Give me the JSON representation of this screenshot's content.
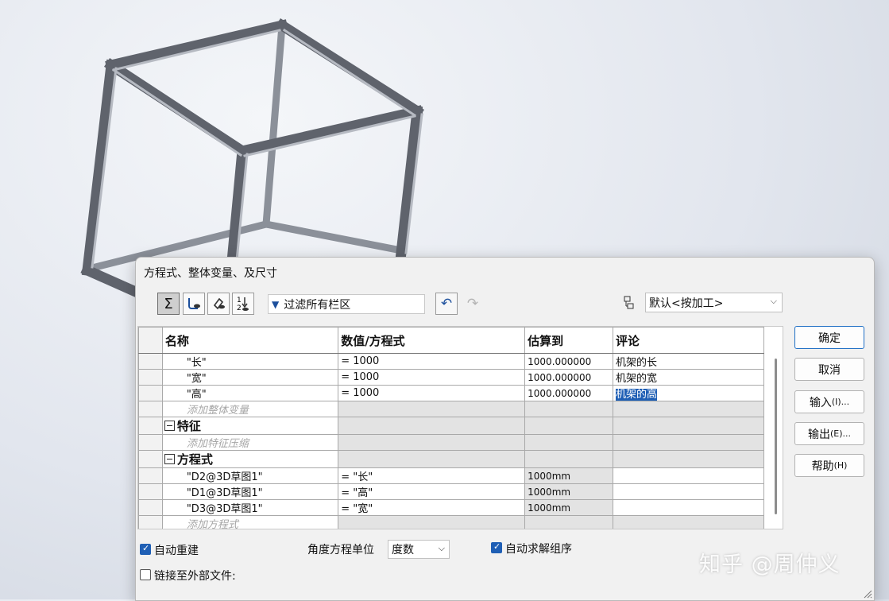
{
  "dialog": {
    "title": "方程式、整体变量、及尺寸",
    "toolbar": {
      "equation_view_icon": "sigma-icon",
      "sketch_equation_view_icon": "sketch-view-icon",
      "dimension_view_icon": "dimension-view-icon",
      "ordered_view_icon": "ordered-view-icon",
      "filter_placeholder": "过滤所有栏区",
      "configuration": "默认<按加工>"
    },
    "table": {
      "headers": [
        "名称",
        "数值/方程式",
        "估算到",
        "评论"
      ],
      "globals": [
        {
          "name": "\"长\"",
          "value": "= 1000",
          "evaluates": "1000.000000",
          "comment": "机架的长"
        },
        {
          "name": "\"宽\"",
          "value": "= 1000",
          "evaluates": "1000.000000",
          "comment": "机架的宽"
        },
        {
          "name": "\"高\"",
          "value": "= 1000",
          "evaluates": "1000.000000",
          "comment": "机架的高"
        }
      ],
      "add_global_hint": "添加整体变量",
      "features_section": "特征",
      "add_feature_hint": "添加特征压缩",
      "equations_section": "方程式",
      "equations": [
        {
          "name": "\"D2@3D草图1\"",
          "value": "= \"长\"",
          "evaluates": "1000mm"
        },
        {
          "name": "\"D1@3D草图1\"",
          "value": "= \"高\"",
          "evaluates": "1000mm"
        },
        {
          "name": "\"D3@3D草图1\"",
          "value": "= \"宽\"",
          "evaluates": "1000mm"
        }
      ],
      "add_equation_hint": "添加方程式"
    },
    "buttons": {
      "ok": "确定",
      "cancel": "取消",
      "import": "输入",
      "import_key": "(I)...",
      "export": "输出",
      "export_key": "(E)...",
      "help": "帮助",
      "help_key": "(H)"
    },
    "options": {
      "auto_rebuild": "自动重建",
      "auto_rebuild_checked": true,
      "angle_unit_label": "角度方程单位",
      "angle_unit_value": "度数",
      "auto_solve": "自动求解组序",
      "auto_solve_checked": true,
      "link_external": "链接至外部文件:",
      "link_external_checked": false
    }
  },
  "watermark": "知乎 @周仲义",
  "colors": {
    "selection": "#1f5fb5",
    "link_blue": "#1c4f9c",
    "frame_steel": "#6f737c"
  }
}
